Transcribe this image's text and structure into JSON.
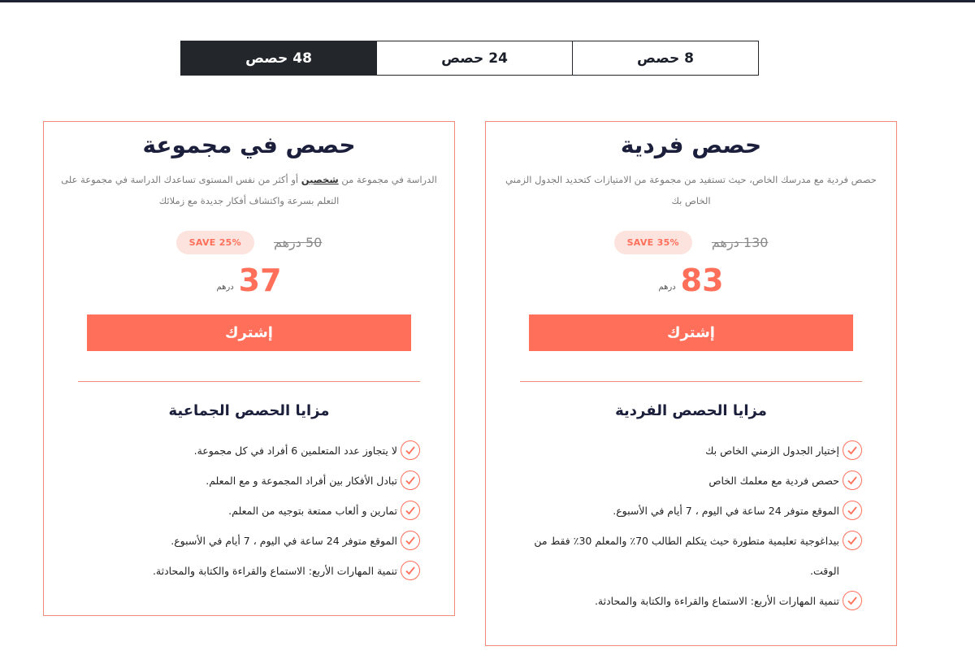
{
  "tabs": [
    {
      "label": "48 حصص",
      "active": true
    },
    {
      "label": "24 حصص",
      "active": false
    },
    {
      "label": "8 حصص",
      "active": false
    }
  ],
  "colors": {
    "accent": "#ff6f5a",
    "dark": "#23262b",
    "badge_bg": "#fde3de",
    "border": "#f08a7a"
  },
  "group": {
    "title": "حصص في مجموعة",
    "desc_part1": "الدراسة في مجموعة من ",
    "desc_bold": "شخصين",
    "desc_part2": " أو أكثر من نفس المستوى تساعدك الدراسة في مجموعة على التعلم بسرعة واكتشاف أفكار جديدة مع زملائك",
    "old_price": "50 درهم",
    "save": "SAVE 25%",
    "price": "37",
    "unit": "درهم",
    "button": "إشترك",
    "features_title": "مزايا الحصص الجماعية",
    "features": [
      "لا يتجاوز عدد المتعلمين 6 أفراد في كل مجموعة.",
      "تبادل الأفكار بين أفراد المجموعة و مع المعلم.",
      "تمارين و ألعاب ممتعة بتوجيه من المعلم.",
      "الموقع متوفر 24 ساعة في اليوم ، 7 أيام في الأسبوع.",
      "تنمية المهارات الأربع: الاستماع والقراءة والكتابة والمحادثة."
    ]
  },
  "individual": {
    "title": "حصص فردية",
    "desc": "حصص فردية مع مدرسك الخاص، حيث تستفيد من مجموعة من الامتيازات كتحديد الجدول الزمني الخاص بك",
    "old_price": "130 درهم",
    "save": "SAVE 35%",
    "price": "83",
    "unit": "درهم",
    "button": "إشترك",
    "features_title": "مزايا الحصص الفردية",
    "features": [
      "إختيار الجدول الزمني الخاص بك",
      "حصص فردية مع معلمك الخاص",
      "الموقع متوفر 24 ساعة في اليوم ، 7 أيام في الأسبوع.",
      "بيداغوجية تعليمية متطورة حيث يتكلم الطالب 70٪ والمعلم 30٪ فقط من الوقت.",
      "تنمية المهارات الأربع: الاستماع والقراءة والكتابة والمحادثة."
    ]
  }
}
